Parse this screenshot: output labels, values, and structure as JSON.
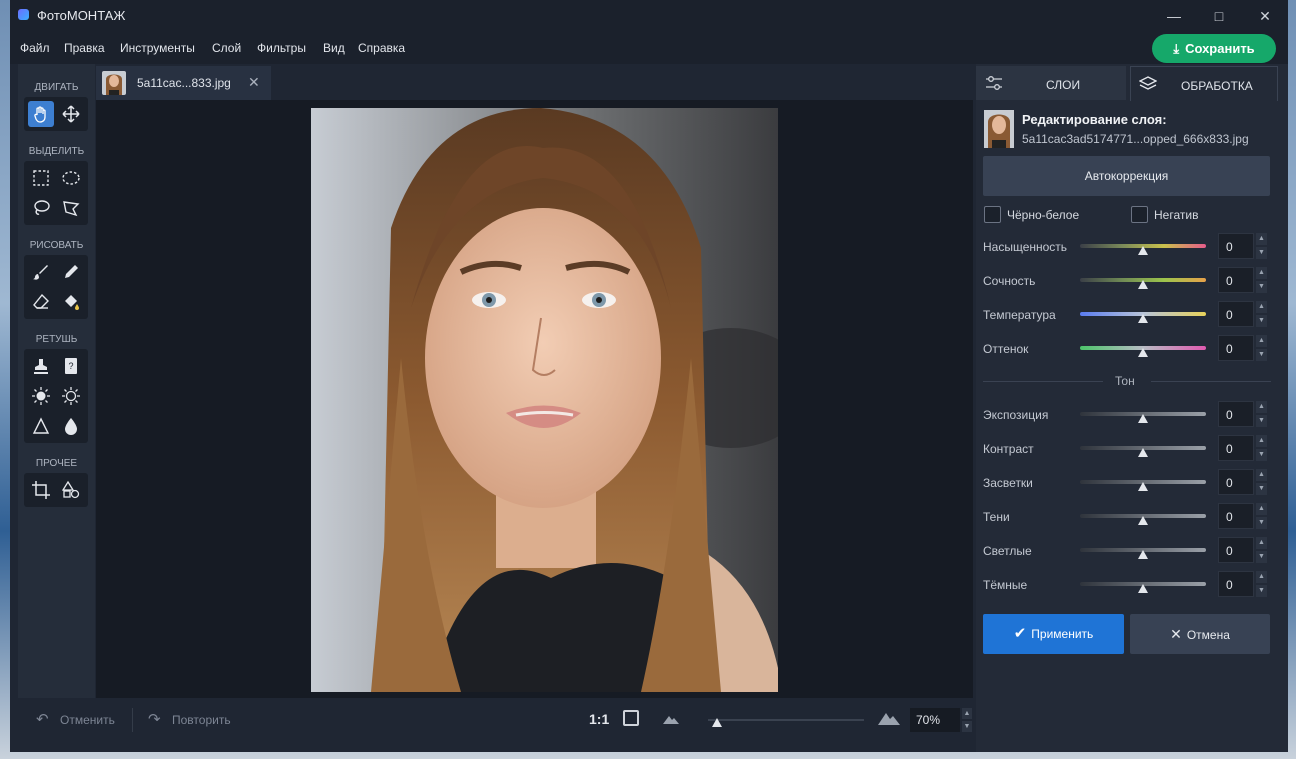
{
  "window": {
    "title": "ФотоМОНТАЖ"
  },
  "menu": [
    "Файл",
    "Правка",
    "Инструменты",
    "Слой",
    "Фильтры",
    "Вид",
    "Справка"
  ],
  "save_label": "Сохранить",
  "toolbar": {
    "sections": [
      "ДВИГАТЬ",
      "ВЫДЕЛИТЬ",
      "РИСОВАТЬ",
      "РЕТУШЬ",
      "ПРОЧЕЕ"
    ]
  },
  "document": {
    "tab_name": "5a11cac...833.jpg"
  },
  "status": {
    "undo": "Отменить",
    "redo": "Повторить",
    "ratio": "1:1",
    "zoom": "70%",
    "zoom_level": 0.07
  },
  "panel": {
    "tab_layers": "СЛОИ",
    "tab_processing": "ОБРАБОТКА",
    "layer_title": "Редактирование слоя:",
    "layer_file": "5a11cac3ad5174771...opped_666x833.jpg",
    "autocorrect": "Автокоррекция",
    "bw": "Чёрно-белое",
    "negative": "Негатив",
    "color_rows": [
      {
        "label": "Насыщенность",
        "value": "0"
      },
      {
        "label": "Сочность",
        "value": "0"
      },
      {
        "label": "Температура",
        "value": "0"
      },
      {
        "label": "Оттенок",
        "value": "0"
      }
    ],
    "tone_header": "Тон",
    "tone_rows": [
      {
        "label": "Экспозиция",
        "value": "0"
      },
      {
        "label": "Контраст",
        "value": "0"
      },
      {
        "label": "Засветки",
        "value": "0"
      },
      {
        "label": "Тени",
        "value": "0"
      },
      {
        "label": "Светлые",
        "value": "0"
      },
      {
        "label": "Тёмные",
        "value": "0"
      }
    ],
    "apply": "Применить",
    "cancel": "Отмена"
  },
  "colors": {
    "accent": "#3d7fd1",
    "save": "#16a86a",
    "apply": "#1f74d6"
  }
}
